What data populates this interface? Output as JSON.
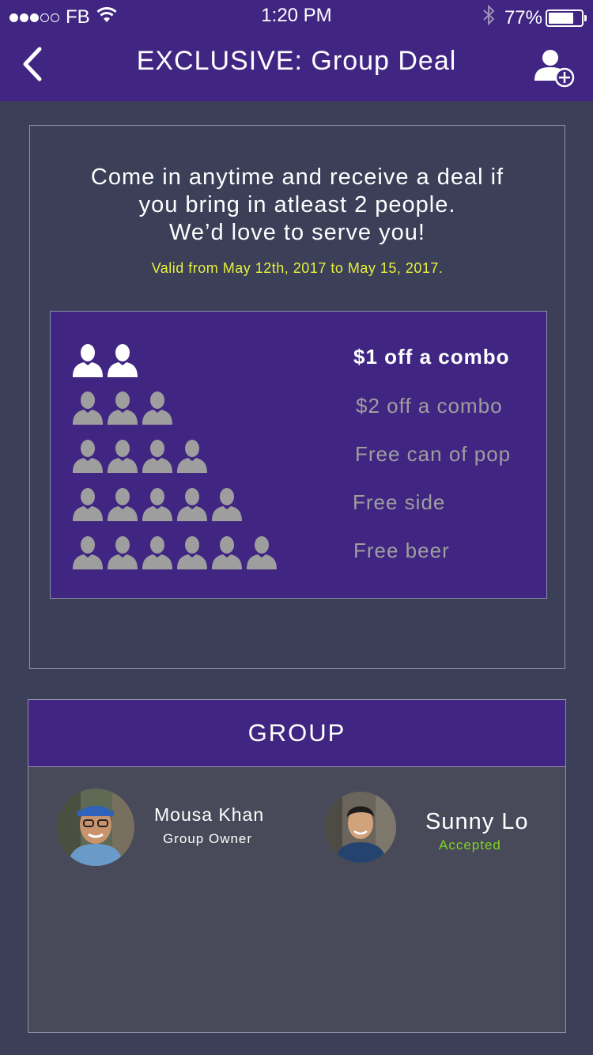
{
  "status_bar": {
    "carrier": "FB",
    "time": "1:20 PM",
    "battery": "77%",
    "battery_level": 0.77,
    "signal_bars_filled": 3,
    "signal_bars_total": 5
  },
  "nav": {
    "title": "EXCLUSIVE: Group Deal",
    "back_icon": "chevron-left-icon",
    "add_icon": "add-user-icon"
  },
  "deal": {
    "description_lines": [
      "Come in anytime and receive a deal if",
      "you bring in atleast 2 people.",
      "We’d love to serve you!"
    ],
    "validity": "Valid from May 12th, 2017 to May 15, 2017.",
    "tiers": [
      {
        "people": 2,
        "label": "$1 off a combo",
        "active": true
      },
      {
        "people": 3,
        "label": "$2 off a combo",
        "active": false
      },
      {
        "people": 4,
        "label": "Free can of pop",
        "active": false
      },
      {
        "people": 5,
        "label": "Free side",
        "active": false
      },
      {
        "people": 6,
        "label": "Free beer",
        "active": false
      }
    ]
  },
  "group": {
    "title": "GROUP",
    "members": [
      {
        "name": "Mousa Khan",
        "role": "Group Owner"
      },
      {
        "name": "Sunny Lo",
        "role": "Accepted"
      }
    ]
  },
  "colors": {
    "header_purple": "#402682",
    "background": "#3b3f58",
    "validity_yellow": "#e6f03c",
    "accepted_green": "#7ed321",
    "inactive_gray": "#9e9e9e"
  }
}
